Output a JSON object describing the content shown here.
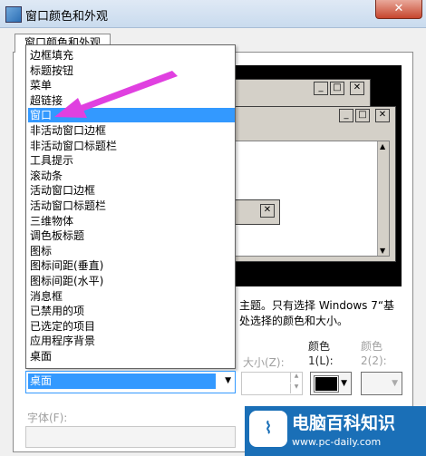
{
  "window": {
    "title": "窗口颜色和外观",
    "close_glyph": "✕"
  },
  "tab": {
    "label": "窗口颜色和外观"
  },
  "preview": {
    "close_glyph": "✕",
    "min_glyph": "_",
    "max_glyph": "□"
  },
  "item_list": [
    "边框填充",
    "标题按钮",
    "菜单",
    "超链接",
    "窗口",
    "非活动窗口边框",
    "非活动窗口标题栏",
    "工具提示",
    "滚动条",
    "活动窗口边框",
    "活动窗口标题栏",
    "三维物体",
    "调色板标题",
    "图标",
    "图标间距(垂直)",
    "图标间距(水平)",
    "消息框",
    "已禁用的项",
    "已选定的项目",
    "应用程序背景",
    "桌面"
  ],
  "selected_index": 4,
  "item_combo": {
    "value": "桌面"
  },
  "description": {
    "line1": "主题。只有选择 Windows 7“基",
    "line2": "处选择的颜色和大小。"
  },
  "size_label": "大小(Z):",
  "color1_label": "颜色",
  "color1_sub": "1(L):",
  "color2_label": "颜色",
  "color2_sub": "2(2):",
  "font_label": "字体(F):",
  "color1_value": "#000000",
  "accent_color": "#3399ff",
  "arrow_color": "#e040e0",
  "watermark": {
    "title": "电脑百科知识",
    "url": "www.pc-daily.com"
  }
}
